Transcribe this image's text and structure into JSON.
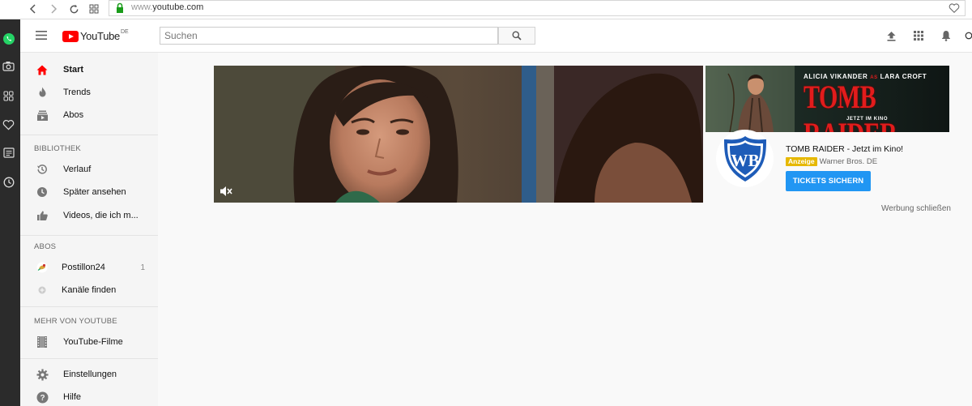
{
  "browser": {
    "url_prefix": "www.",
    "url_domain": "youtube.com"
  },
  "masthead": {
    "logo_text": "YouTube",
    "country_code": "DE",
    "search_placeholder": "Suchen"
  },
  "sidebar": {
    "main_items": [
      {
        "label": "Start",
        "icon": "home-icon",
        "active": true
      },
      {
        "label": "Trends",
        "icon": "flame-icon"
      },
      {
        "label": "Abos",
        "icon": "subscriptions-icon"
      }
    ],
    "library_heading": "BIBLIOTHEK",
    "library_items": [
      {
        "label": "Verlauf",
        "icon": "history-icon"
      },
      {
        "label": "Später ansehen",
        "icon": "clock-icon"
      },
      {
        "label": "Videos, die ich m...",
        "icon": "thumb-up-icon"
      }
    ],
    "subs_heading": "ABOS",
    "subs_items": [
      {
        "label": "Postillon24",
        "count": "1",
        "icon": "channel-avatar"
      },
      {
        "label": "Kanäle finden",
        "icon": "plus-circle-icon"
      }
    ],
    "more_heading": "MEHR VON YOUTUBE",
    "more_items": [
      {
        "label": "YouTube-Filme",
        "icon": "film-icon"
      }
    ],
    "settings_items": [
      {
        "label": "Einstellungen",
        "icon": "gear-icon"
      },
      {
        "label": "Hilfe",
        "icon": "help-icon"
      }
    ]
  },
  "ad": {
    "banner_top_a": "ALICIA VIKANDER",
    "banner_top_by": "AS",
    "banner_top_b": "LARA CROFT",
    "banner_title": "TOMB RAIDER",
    "banner_sub": "JETZT IM KINO",
    "title": "TOMB RAIDER - Jetzt im Kino!",
    "badge": "Anzeige",
    "advertiser": "Warner Bros. DE",
    "cta": "TICKETS SICHERN",
    "close": "Werbung schließen"
  },
  "colors": {
    "brand_red": "#ff0000",
    "cta_blue": "#2196f3",
    "ad_badge": "#e6b800"
  }
}
